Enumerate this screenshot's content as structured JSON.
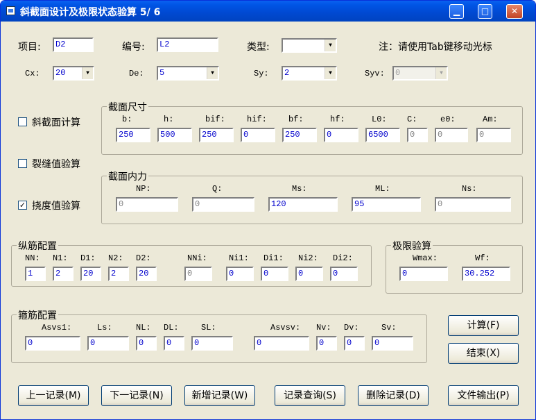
{
  "window": {
    "title": "斜截面设计及极限状态验算 5/ 6"
  },
  "top": {
    "project_label": "项目:",
    "project_value": "D2",
    "number_label": "编号:",
    "number_value": "L2",
    "type_label": "类型:",
    "type_value": "",
    "note": "注：请使用Tab键移动光标",
    "cx_label": "Cx:",
    "cx_value": "20",
    "de_label": "De:",
    "de_value": "5",
    "sy_label": "Sy:",
    "sy_value": "2",
    "syv_label": "Syv:",
    "syv_value": "0"
  },
  "checks": {
    "oblique": {
      "label": "斜截面计算",
      "checked": false
    },
    "crack": {
      "label": "裂缝值验算",
      "checked": false
    },
    "deflection": {
      "label": "挠度值验算",
      "checked": true
    },
    "check_mark": "✓"
  },
  "section_size": {
    "title": "截面尺寸",
    "fields": [
      {
        "label": "b:",
        "value": "250"
      },
      {
        "label": "h:",
        "value": "500"
      },
      {
        "label": "bif:",
        "value": "250"
      },
      {
        "label": "hif:",
        "value": "0"
      },
      {
        "label": "bf:",
        "value": "250"
      },
      {
        "label": "hf:",
        "value": "0"
      },
      {
        "label": "L0:",
        "value": "6500"
      },
      {
        "label": "C:",
        "value": "0"
      },
      {
        "label": "e0:",
        "value": "0"
      },
      {
        "label": "Am:",
        "value": "0"
      }
    ]
  },
  "internal_force": {
    "title": "截面内力",
    "fields": [
      {
        "label": "NP:",
        "value": "0"
      },
      {
        "label": "Q:",
        "value": "0"
      },
      {
        "label": "Ms:",
        "value": "120"
      },
      {
        "label": "ML:",
        "value": "95"
      },
      {
        "label": "Ns:",
        "value": "0"
      }
    ]
  },
  "longitudinal": {
    "title": "纵筋配置",
    "fields": [
      {
        "label": "NN:",
        "value": "1"
      },
      {
        "label": "N1:",
        "value": "2"
      },
      {
        "label": "D1:",
        "value": "20"
      },
      {
        "label": "N2:",
        "value": "2"
      },
      {
        "label": "D2:",
        "value": "20"
      },
      {
        "label": "NNi:",
        "value": "0"
      },
      {
        "label": "Ni1:",
        "value": "0"
      },
      {
        "label": "Di1:",
        "value": "0"
      },
      {
        "label": "Ni2:",
        "value": "0"
      },
      {
        "label": "Di2:",
        "value": "0"
      }
    ]
  },
  "limit_check": {
    "title": "极限验算",
    "fields": [
      {
        "label": "Wmax:",
        "value": "0"
      },
      {
        "label": "Wf:",
        "value": "30.252"
      }
    ]
  },
  "stirrup": {
    "title": "箍筋配置",
    "fields": [
      {
        "label": "Asvs1:",
        "value": "0"
      },
      {
        "label": "Ls:",
        "value": "0"
      },
      {
        "label": "NL:",
        "value": "0"
      },
      {
        "label": "DL:",
        "value": "0"
      },
      {
        "label": "SL:",
        "value": "0"
      },
      {
        "label": "Asvsv:",
        "value": "0"
      },
      {
        "label": "Nv:",
        "value": "0"
      },
      {
        "label": "Dv:",
        "value": "0"
      },
      {
        "label": "Sv:",
        "value": "0"
      }
    ]
  },
  "buttons": {
    "calc": "计算(F)",
    "end": "结束(X)",
    "prev": "上一记录(M)",
    "next": "下一记录(N)",
    "new": "新增记录(W)",
    "query": "记录查询(S)",
    "delete": "删除记录(D)",
    "export": "文件输出(P)"
  },
  "icons": {
    "minimize": "minimize-icon",
    "maximize": "maximize-icon",
    "close": "close-icon",
    "dropdown": "chevron-down-icon"
  }
}
